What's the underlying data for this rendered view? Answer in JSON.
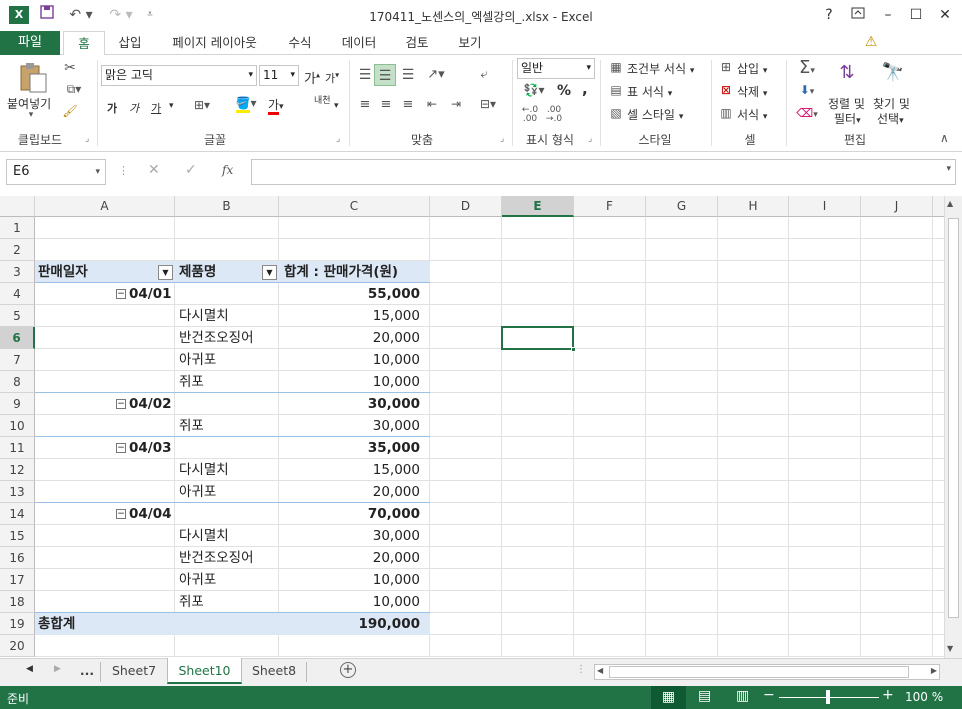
{
  "window": {
    "app_icon": "X",
    "title": "170411_노센스의_엑셀강의_.xlsx - Excel",
    "help": "?"
  },
  "tabs": {
    "file": "파일",
    "home": "홈",
    "insert": "삽입",
    "layout": "페이지 레이아웃",
    "formulas": "수식",
    "data": "데이터",
    "review": "검토",
    "view": "보기"
  },
  "ribbon": {
    "clipboard": {
      "paste": "붙여넣기",
      "group": "클립보드"
    },
    "font": {
      "name": "맑은 고딕",
      "size": "11",
      "bold": "가",
      "italic": "가",
      "underline": "가",
      "grow": "가",
      "shrink": "가",
      "color_char": "가",
      "phonetic": "내천",
      "group": "글꼴"
    },
    "align": {
      "group": "맞춤"
    },
    "number": {
      "format": "일반",
      "percent": "%",
      "comma": ",",
      "group": "표시 형식"
    },
    "styles": {
      "conditional": "조건부 서식",
      "table": "표 서식",
      "cell": "셀 스타일",
      "group": "스타일"
    },
    "cells": {
      "insert": "삽입",
      "delete": "삭제",
      "format": "서식",
      "group": "셀"
    },
    "editing": {
      "sort_1": "정렬 및",
      "sort_2": "필터",
      "find_1": "찾기 및",
      "find_2": "선택",
      "group": "편집"
    }
  },
  "formula_bar": {
    "name_box": "E6",
    "fx": "fx",
    "value": ""
  },
  "columns": [
    "A",
    "B",
    "C",
    "D",
    "E",
    "F",
    "G",
    "H",
    "I",
    "J"
  ],
  "rows": [
    "1",
    "2",
    "3",
    "4",
    "5",
    "6",
    "7",
    "8",
    "9",
    "10",
    "11",
    "12",
    "13",
    "14",
    "15",
    "16",
    "17",
    "18",
    "19",
    "20"
  ],
  "pivot": {
    "header_date": "판매일자",
    "header_product": "제품명",
    "header_sum": "합계 : 판매가격(원)",
    "groups": [
      {
        "date": "04/01",
        "total": "55,000",
        "items": [
          [
            "다시멸치",
            "15,000"
          ],
          [
            "반건조오징어",
            "20,000"
          ],
          [
            "아귀포",
            "10,000"
          ],
          [
            "쥐포",
            "10,000"
          ]
        ]
      },
      {
        "date": "04/02",
        "total": "30,000",
        "items": [
          [
            "쥐포",
            "30,000"
          ]
        ]
      },
      {
        "date": "04/03",
        "total": "35,000",
        "items": [
          [
            "다시멸치",
            "15,000"
          ],
          [
            "아귀포",
            "20,000"
          ]
        ]
      },
      {
        "date": "04/04",
        "total": "70,000",
        "items": [
          [
            "다시멸치",
            "30,000"
          ],
          [
            "반건조오징어",
            "20,000"
          ],
          [
            "아귀포",
            "10,000"
          ],
          [
            "쥐포",
            "10,000"
          ]
        ]
      }
    ],
    "grand_total_label": "총합계",
    "grand_total": "190,000"
  },
  "sheets": {
    "more": "...",
    "list": [
      "Sheet7",
      "Sheet10",
      "Sheet8"
    ],
    "active": "Sheet10"
  },
  "status": {
    "ready": "준비",
    "zoom": "100 %"
  },
  "colors": {
    "excel_green": "#217346",
    "pivot_header": "#dde8f6",
    "pivot_line": "#9bc2e6"
  }
}
